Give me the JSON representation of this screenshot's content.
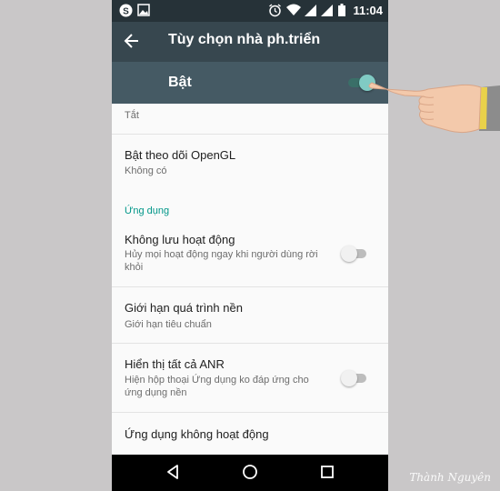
{
  "statusbar": {
    "time": "11:04",
    "icons_left": [
      "skype-icon",
      "image-icon"
    ],
    "icons_right": [
      "alarm-icon",
      "wifi-icon",
      "signal-icon",
      "signal-icon",
      "battery-icon"
    ]
  },
  "appbar": {
    "title": "Tùy chọn nhà ph.triển"
  },
  "master": {
    "label": "Bật",
    "enabled": true
  },
  "rows": [
    {
      "subtitle": "Tắt"
    },
    {
      "title": "Bật theo dõi OpenGL",
      "subtitle": "Không có"
    },
    {
      "title": "Không lưu hoạt động",
      "subtitle": "Hủy mọi hoạt động ngay khi người dùng rời khỏi",
      "switch": false
    },
    {
      "title": "Giới hạn quá trình nền",
      "subtitle": "Giới hạn tiêu chuẩn"
    },
    {
      "title": "Hiển thị tất cả ANR",
      "subtitle": "Hiện hộp thoại Ứng dụng ko đáp ứng cho ứng dụng nền",
      "switch": false
    },
    {
      "title": "Ứng dụng không hoạt động"
    }
  ],
  "section_header": "Ứng dụng",
  "colors": {
    "statusbar": "#263238",
    "appbar": "#37474f",
    "masterbar": "#455a64",
    "accent": "#009688",
    "switch_on": "#80cbc4"
  },
  "watermark": "Thành Nguyên"
}
